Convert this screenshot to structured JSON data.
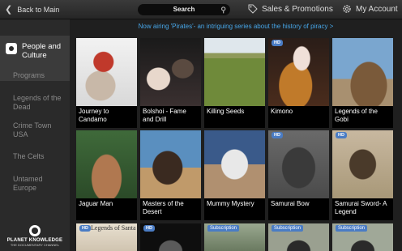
{
  "header": {
    "back_label": "Back to Main",
    "search_label": "Search",
    "sales_label": "Sales & Promotions",
    "account_label": "My Account"
  },
  "sidebar": {
    "active": "People and Culture",
    "items": [
      "Programs",
      "Legends of the Dead",
      "Crime Town USA",
      "The Celts",
      "Untamed Europe"
    ]
  },
  "banner": "Now airing 'Pirates'- an intriguing series about the history of piracy >",
  "logo": {
    "name": "PLANET KNOWLEDGE",
    "sub": "THE DOCUMENTARY CHANNEL"
  },
  "tiles_row1": [
    {
      "caption": "Journey to Candamo",
      "badge": ""
    },
    {
      "caption": "Bolshoi - Fame and Drill",
      "badge": ""
    },
    {
      "caption": "Killing Seeds",
      "badge": ""
    },
    {
      "caption": "Kimono",
      "badge": "HD"
    },
    {
      "caption": "Legends of the Gobi",
      "badge": ""
    }
  ],
  "tiles_row2": [
    {
      "caption": "Jaguar Man",
      "badge": ""
    },
    {
      "caption": "Masters of the Desert",
      "badge": ""
    },
    {
      "caption": "Mummy Mystery",
      "badge": ""
    },
    {
      "caption": "Samurai Bow",
      "badge": "HD"
    },
    {
      "caption": "Samurai Sword- A Legend",
      "badge": "HD"
    }
  ],
  "tiles_row3": [
    {
      "badge": "HD",
      "art_text": "Legends of Santa"
    },
    {
      "badge": "HD"
    },
    {
      "badge": "Subscription"
    },
    {
      "badge": "Subscription"
    },
    {
      "badge": "Subscription"
    }
  ],
  "colors": {
    "accent": "#47a6e8",
    "badge": "#4a7cc4"
  }
}
